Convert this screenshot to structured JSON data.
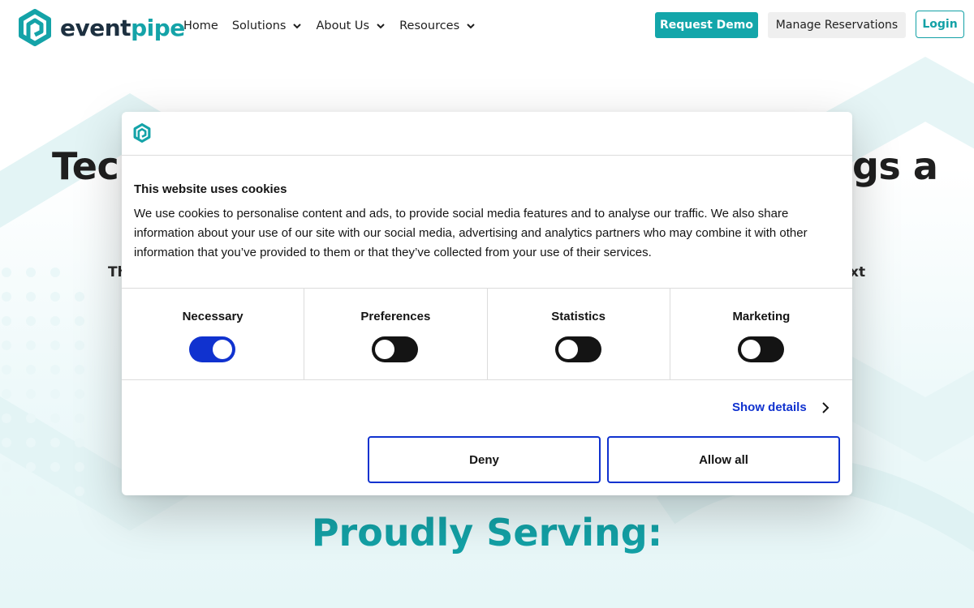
{
  "nav": {
    "brand_part1": "event",
    "brand_part2": "pipe",
    "menu": [
      {
        "label": "Home",
        "has_dropdown": false
      },
      {
        "label": "Solutions",
        "has_dropdown": true
      },
      {
        "label": "About Us",
        "has_dropdown": true
      },
      {
        "label": "Resources",
        "has_dropdown": true
      }
    ],
    "request_demo": "Request Demo",
    "manage_reservations": "Manage Reservations",
    "login": "Login"
  },
  "hero": {
    "title_visible_left": "Tec",
    "title_visible_right": "gs a",
    "subtitle_visible_left": "Th",
    "subtitle_visible_right": "xt",
    "proudly": "Proudly Serving:"
  },
  "cookie_dialog": {
    "title": "This website uses cookies",
    "body": "We use cookies to personalise content and ads, to provide social media features and to analyse our traffic. We also share information about your use of our site with our social media, advertising and analytics partners who may combine it with other information that you’ve provided to them or that they’ve collected from your use of their services.",
    "toggles": [
      {
        "label": "Necessary",
        "on": true
      },
      {
        "label": "Preferences",
        "on": false
      },
      {
        "label": "Statistics",
        "on": false
      },
      {
        "label": "Marketing",
        "on": false
      }
    ],
    "show_details": "Show details",
    "deny": "Deny",
    "allow_all": "Allow all"
  },
  "colors": {
    "brand_teal": "#13a6aa",
    "brand_dark": "#1d3040",
    "consent_blue": "#1032cf",
    "toggle_off": "#141414"
  },
  "icons": {
    "logo": "eventpipe-hexagon-logo",
    "dropdown": "chevron-down-icon",
    "details": "chevron-right-icon"
  }
}
